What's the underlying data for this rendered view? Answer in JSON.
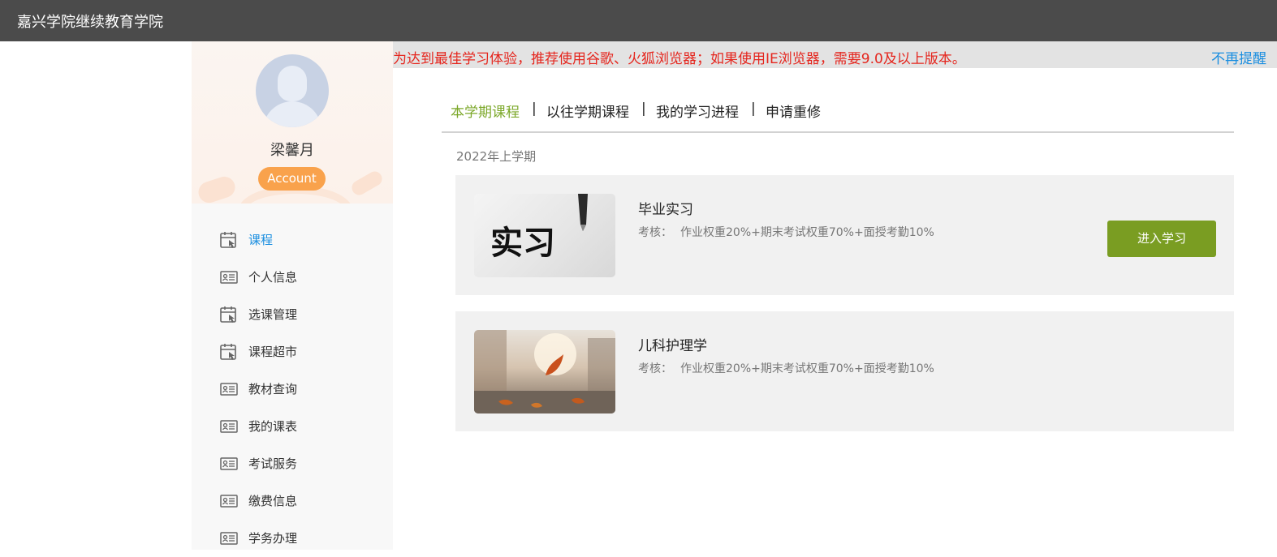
{
  "header": {
    "title": "嘉兴学院继续教育学院"
  },
  "profile": {
    "name": "梁馨月",
    "account_label": "Account"
  },
  "sidebar": {
    "items": [
      {
        "label": "课程",
        "icon": "calendar-pointer-icon",
        "active": true
      },
      {
        "label": "个人信息",
        "icon": "id-card-icon"
      },
      {
        "label": "选课管理",
        "icon": "calendar-pointer-icon"
      },
      {
        "label": "课程超市",
        "icon": "calendar-pointer-icon"
      },
      {
        "label": "教材查询",
        "icon": "id-card-icon"
      },
      {
        "label": "我的课表",
        "icon": "id-card-icon"
      },
      {
        "label": "考试服务",
        "icon": "id-card-icon"
      },
      {
        "label": "缴费信息",
        "icon": "id-card-icon"
      },
      {
        "label": "学务办理",
        "icon": "id-card-icon"
      }
    ]
  },
  "notice": {
    "message": "为达到最佳学习体验，推荐使用谷歌、火狐浏览器；如果使用IE浏览器，需要9.0及以上版本。",
    "dismiss": "不再提醒"
  },
  "tabs": [
    {
      "label": "本学期课程",
      "active": true
    },
    {
      "label": "以往学期课程"
    },
    {
      "label": "我的学习进程"
    },
    {
      "label": "申请重修"
    }
  ],
  "separator": "|",
  "term": "2022年上学期",
  "courses": [
    {
      "title": "毕业实习",
      "assess_label": "考核：",
      "assess": "作业权重20%+期末考试权重70%+面授考勤10%",
      "button": "进入学习",
      "thumb_text": "实习"
    },
    {
      "title": "儿科护理学",
      "assess_label": "考核：",
      "assess": "作业权重20%+期末考试权重70%+面授考勤10%"
    }
  ],
  "colors": {
    "accent_green": "#7a9d22",
    "tab_active": "#7ca82a",
    "link_blue": "#1a8ee0",
    "notice_red": "#e5251d",
    "account_orange": "#f9a24c"
  }
}
